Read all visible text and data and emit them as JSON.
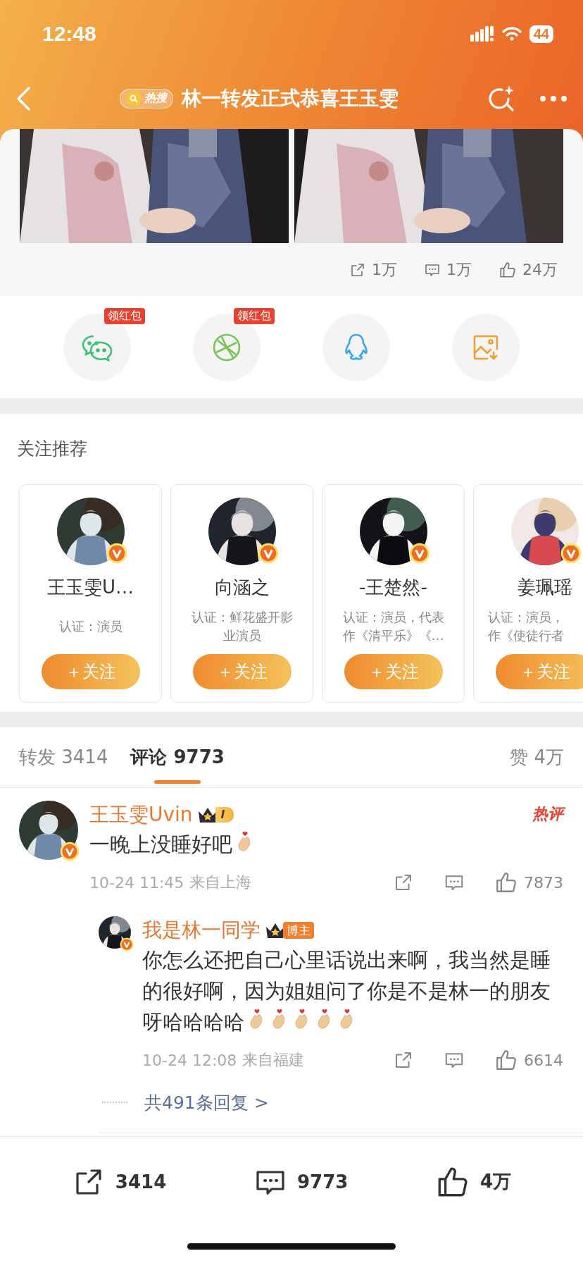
{
  "status_bar": {
    "time": "12:48",
    "battery": "44"
  },
  "nav": {
    "badge": "热搜",
    "title": "林一转发正式恭喜王玉雯"
  },
  "post": {
    "stats": {
      "reposts": "1万",
      "comments": "1万",
      "likes": "24万"
    }
  },
  "share": [
    {
      "kind": "wechat",
      "badge": "领红包"
    },
    {
      "kind": "moments",
      "badge": "领红包"
    },
    {
      "kind": "qq"
    },
    {
      "kind": "save-image"
    }
  ],
  "recommend": {
    "title": "关注推荐",
    "cards": [
      {
        "name": "王玉雯U…",
        "cert": [
          "认证：演员"
        ],
        "button": "＋关注"
      },
      {
        "name": "向涵之",
        "cert": [
          "认证：鲜花盛开影",
          "业演员"
        ],
        "button": "＋关注"
      },
      {
        "name": "-王楚然-",
        "cert": [
          "认证：演员，代表",
          "作《清平乐》《…"
        ],
        "button": "＋关注"
      },
      {
        "name": "姜珮瑶",
        "cert": [
          "认证：演员，",
          "作《使徒行者"
        ],
        "button": "＋关注"
      }
    ]
  },
  "tabs": [
    {
      "label": "转发",
      "count": "3414",
      "selected": false
    },
    {
      "label": "评论",
      "count": "9773",
      "selected": true
    },
    {
      "label": "赞",
      "count": "4万",
      "selected": false
    }
  ],
  "comment": {
    "name": "王玉雯Uvin",
    "level": "I",
    "hot": "热评",
    "text": "一晚上没睡好吧",
    "time": "10-24 11:45",
    "location": "来自上海",
    "likes": "7873",
    "reply": {
      "name": "我是林一同学",
      "tag": "博主",
      "text": "你怎么还把自己心里话说出来啊，我当然是睡的很好啊，因为姐姐问了你是不是林一的朋友呀哈哈哈哈",
      "time": "10-24 12:08",
      "location": "来自福建",
      "likes": "6614"
    },
    "more": "共491条回复 >"
  },
  "bottom_bar": {
    "reposts": "3414",
    "comments": "9773",
    "likes": "4万"
  }
}
